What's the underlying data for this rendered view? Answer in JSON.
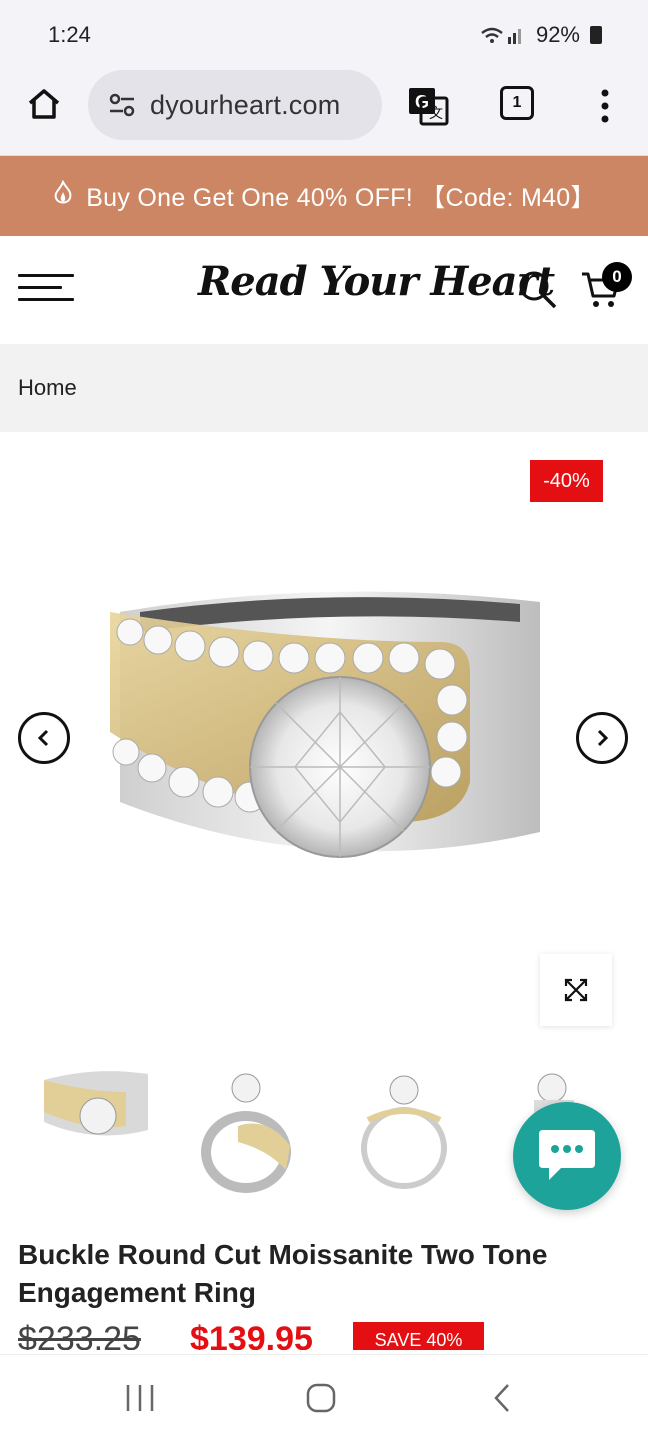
{
  "status": {
    "time": "1:24",
    "battery": "92%"
  },
  "browser": {
    "url": "dyourheart.com",
    "tab_count": "1"
  },
  "promo": {
    "text": "Buy One Get One 40% OFF! 【Code: M40】"
  },
  "header": {
    "logo": "Read Your Heart",
    "cart_count": "0"
  },
  "breadcrumb": {
    "home": "Home"
  },
  "gallery": {
    "discount_badge": "-40%"
  },
  "product": {
    "title": "Buckle Round Cut Moissanite Two Tone Engagement Ring",
    "old_price": "$233.25",
    "new_price": "$139.95",
    "save_label": "SAVE 40%"
  },
  "colors": {
    "promo": "#cd8663",
    "accent_red": "#e40f12",
    "chat": "#1da39a"
  },
  "icons": [
    "home-icon",
    "site-settings-icon",
    "translate-icon",
    "tabs-icon",
    "more-icon",
    "menu-icon",
    "search-icon",
    "cart-icon",
    "chevron-left-icon",
    "chevron-right-icon",
    "expand-icon",
    "chat-icon"
  ]
}
